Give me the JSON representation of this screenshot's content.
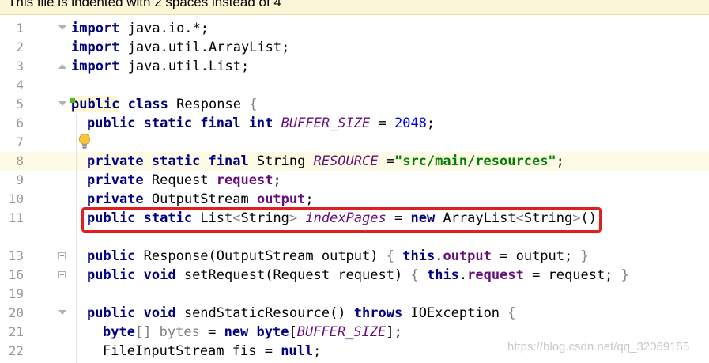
{
  "banner": {
    "text": "This file is indented with 2 spaces instead of 4"
  },
  "lines": [
    {
      "num": "1"
    },
    {
      "num": "2"
    },
    {
      "num": "3"
    },
    {
      "num": "4"
    },
    {
      "num": "5"
    },
    {
      "num": "6"
    },
    {
      "num": "7"
    },
    {
      "num": "8"
    },
    {
      "num": "9"
    },
    {
      "num": "10"
    },
    {
      "num": "11"
    },
    {
      "num": "13"
    },
    {
      "num": "16"
    },
    {
      "num": "19"
    },
    {
      "num": "20"
    },
    {
      "num": "21"
    },
    {
      "num": "22"
    }
  ],
  "code": {
    "l1": {
      "kw": "import",
      "rest": " java.io.*;"
    },
    "l2": {
      "kw": "import",
      "rest": " java.util.ArrayList;"
    },
    "l3": {
      "kw": "import",
      "rest": " java.util.List;"
    },
    "l5": {
      "kw1": "public",
      "kw2": " class",
      "rest": " Response ",
      "brace": "{"
    },
    "l6": {
      "kw": "public static final int",
      "fld": "BUFFER_SIZE",
      "eq": " = ",
      "num": "2048",
      "end": ";"
    },
    "l8": {
      "kw": "private static final",
      "type": " String ",
      "fld": "RESOURCE",
      "eq": " =",
      "str": "\"src/main/resources\"",
      "end": ";"
    },
    "l9": {
      "kw": "private",
      "type": " Request ",
      "fld": "request",
      "end": ";"
    },
    "l10": {
      "kw": "private",
      "type": " OutputStream ",
      "fld": "output",
      "end": ";"
    },
    "l11": {
      "kw": "public static",
      "t1": " List",
      "lt": "<",
      "t2": "String",
      "gt": ">",
      "fld": "indexPages",
      "eq": " = ",
      "kw2": "new",
      "t3": " ArrayList",
      "lt2": "<",
      "t4": "String",
      "gt2": ">",
      "paren": "()",
      "end": ";"
    },
    "l13": {
      "kw": "public",
      "m": " Response",
      "p1": "(",
      "args": "OutputStream output",
      "p2": ")",
      "b1": "{",
      "kw2": "this",
      "dot": ".",
      "fld": "output",
      "rest": " = output; ",
      "b2": "}"
    },
    "l16": {
      "kw": "public void",
      "m": " setRequest",
      "p1": "(",
      "args": "Request request",
      "p2": ")",
      "b1": "{",
      "kw2": "this",
      "dot": ".",
      "fld": "request",
      "rest": " = request; ",
      "b2": "}"
    },
    "l20": {
      "kw": "public void",
      "m": " sendStaticResource",
      "paren": "()",
      "kw2": "throws",
      "rest": " IOException ",
      "brace": "{"
    },
    "l21": {
      "kw": "byte",
      "br": "[]",
      "var": " bytes",
      "eq": " = ",
      "kw2": "new",
      "kw3": " byte",
      "lb": "[",
      "fld": "BUFFER_SIZE",
      "rb": "]",
      "end": ";"
    },
    "l22": {
      "type": "FileInputStream fis",
      "eq": " = ",
      "kw": "null",
      "end": ";"
    }
  },
  "watermark": "https://blog.csdn.net/qq_32069155",
  "colors": {
    "keyword": "#000080",
    "string": "#008000",
    "number": "#0000ff",
    "field": "#660e7a",
    "highlight_box": "#e02020"
  }
}
